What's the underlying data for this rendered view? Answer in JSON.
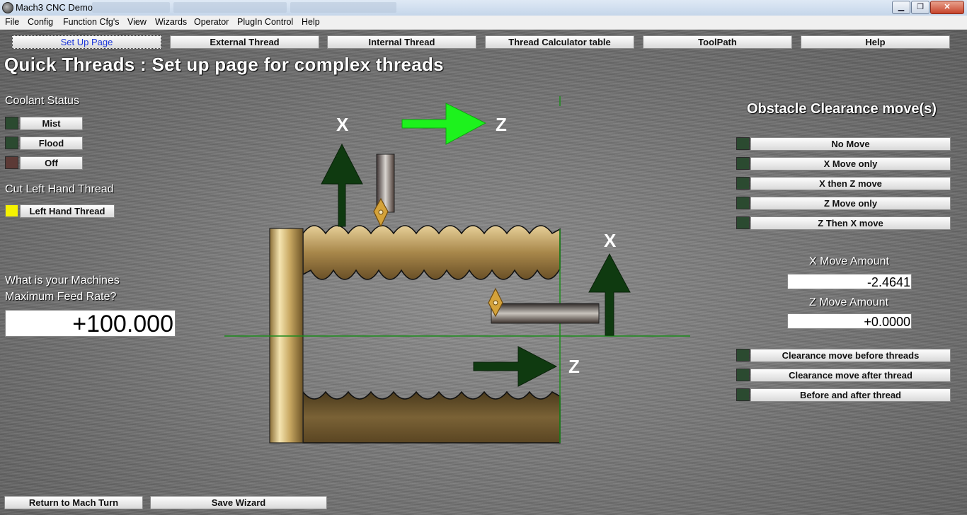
{
  "window": {
    "title": "Mach3 CNC  Demo",
    "minimize": "▁",
    "maximize": "❐",
    "close": "✕"
  },
  "menu": [
    "File",
    "Config",
    "Function Cfg's",
    "View",
    "Wizards",
    "Operator",
    "PlugIn Control",
    "Help"
  ],
  "tabs": [
    "Set Up Page",
    "External Thread",
    "Internal Thread",
    "Thread Calculator table",
    "ToolPath",
    "Help"
  ],
  "active_tab": "Set Up Page",
  "page_title": "Quick Threads : Set up page for complex threads",
  "coolant": {
    "heading": "Coolant Status",
    "buttons": [
      "Mist",
      "Flood",
      "Off"
    ],
    "led_colors": [
      "#2b4a30",
      "#2b4a30",
      "#5c3a36"
    ]
  },
  "left_hand": {
    "heading": "Cut Left Hand Thread",
    "button": "Left Hand Thread",
    "led_color": "#f5f200"
  },
  "feed": {
    "label_line1": "What is your Machines",
    "label_line2": "Maximum Feed Rate?",
    "value": "+100.000"
  },
  "obstacle": {
    "heading": "Obstacle Clearance move(s)",
    "options": [
      "No Move",
      "X Move only",
      "X then Z move",
      "Z Move only",
      "Z Then X move"
    ]
  },
  "x_move": {
    "label": "X Move Amount",
    "value": "-2.4641"
  },
  "z_move": {
    "label": "Z Move Amount",
    "value": "+0.0000"
  },
  "clearance": {
    "options": [
      "Clearance move before threads",
      "Clearance move after thread",
      "Before and after thread"
    ]
  },
  "footer": {
    "return": "Return to Mach Turn",
    "save": "Save Wizard"
  },
  "diagram": {
    "x_label": "X",
    "z_label": "Z"
  },
  "colors": {
    "arrow_dark": "#0f3a10",
    "arrow_bright": "#1df21d",
    "axis_line": "#1c8c1c",
    "brass": "#b89a5c"
  }
}
